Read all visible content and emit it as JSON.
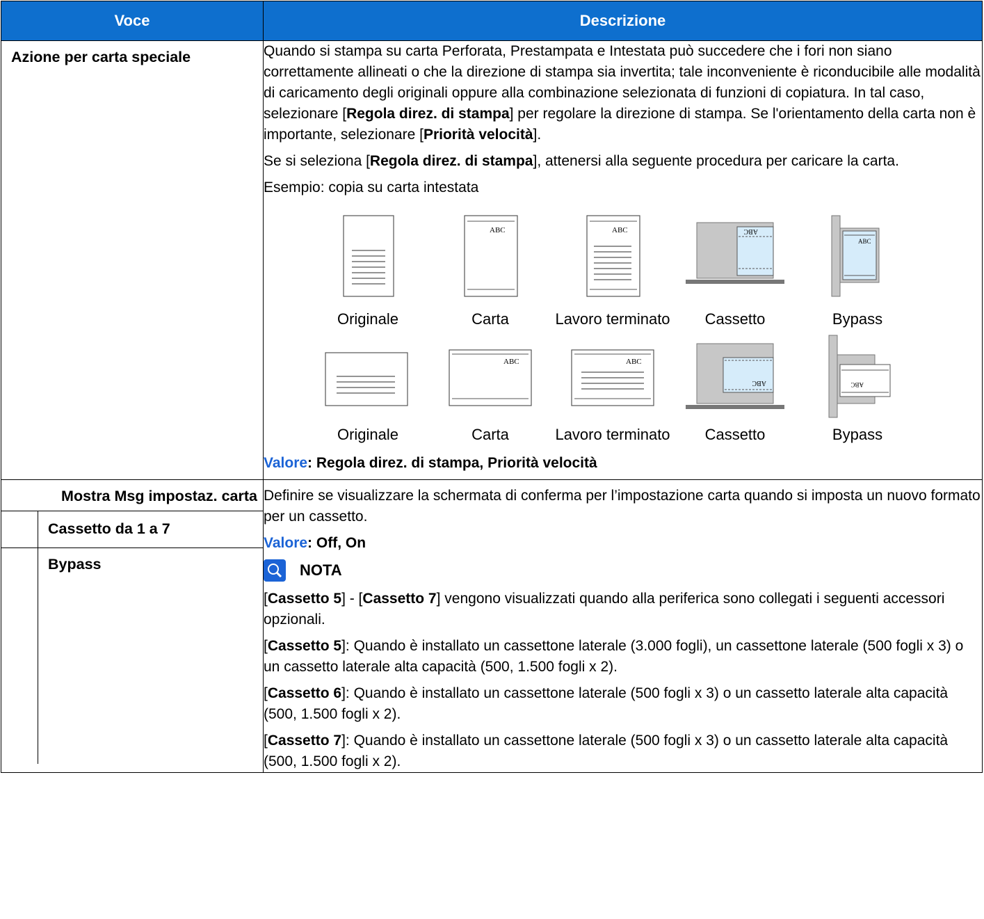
{
  "header": {
    "col1": "Voce",
    "col2": "Descrizione"
  },
  "row1": {
    "label": "Azione per carta speciale",
    "para1_a": "Quando si stampa su carta Perforata, Prestampata e Intestata può succedere che i fori non siano correttamente allineati o che la direzione di stampa sia invertita; tale inconveniente è riconducibile alle modalità di caricamento degli originali oppure alla combinazione selezionata di funzioni di copiatura. In tal caso, selezionare [",
    "para1_b1": "Regola direz. di stampa",
    "para1_c": "] per regolare la direzione di stampa. Se l'orientamento della carta non è importante, selezionare [",
    "para1_b2": "Priorità velocità",
    "para1_d": "].",
    "para2_a": "Se si seleziona [",
    "para2_b": "Regola direz. di stampa",
    "para2_c": "], attenersi alla seguente procedura per caricare la carta.",
    "para3": "Esempio: copia su carta intestata",
    "fig_text_abc": "ABC",
    "captions_row1": [
      "Originale",
      "Carta",
      "Lavoro terminato",
      "Cassetto",
      "Bypass"
    ],
    "captions_row2": [
      "Originale",
      "Carta",
      "Lavoro terminato",
      "Cassetto",
      "Bypass"
    ],
    "valore_key": "Valore",
    "valore_val": ": Regola direz. di stampa, Priorità velocità"
  },
  "row2": {
    "label": "Mostra Msg impostaz. carta",
    "sub1": "Cassetto da 1 a 7",
    "sub2": "Bypass",
    "desc": "Definire se visualizzare la schermata di conferma per l’impostazione carta quando si imposta un nuovo formato per un cassetto.",
    "valore_key": "Valore",
    "valore_val": ": Off, On",
    "nota_title": "NOTA",
    "nota1_a": "[",
    "nota1_b": "Cassetto 5",
    "nota1_c": "] - [",
    "nota1_d": "Cassetto 7",
    "nota1_e": "] vengono visualizzati quando alla periferica sono collegati i seguenti accessori opzionali.",
    "nota2_b": "Cassetto 5",
    "nota2_c": "]: Quando è installato un cassettone laterale (3.000 fogli), un cassettone laterale (500 fogli x 3) o un cassetto laterale alta capacità (500, 1.500 fogli x 2).",
    "nota3_b": "Cassetto 6",
    "nota3_c": "]: Quando è installato un cassettone laterale (500 fogli x 3) o un cassetto laterale alta capacità (500, 1.500 fogli x 2).",
    "nota4_b": "Cassetto 7",
    "nota4_c": "]: Quando è installato un cassettone laterale (500 fogli x 3) o un cassetto laterale alta capacità (500, 1.500 fogli x 2)."
  }
}
